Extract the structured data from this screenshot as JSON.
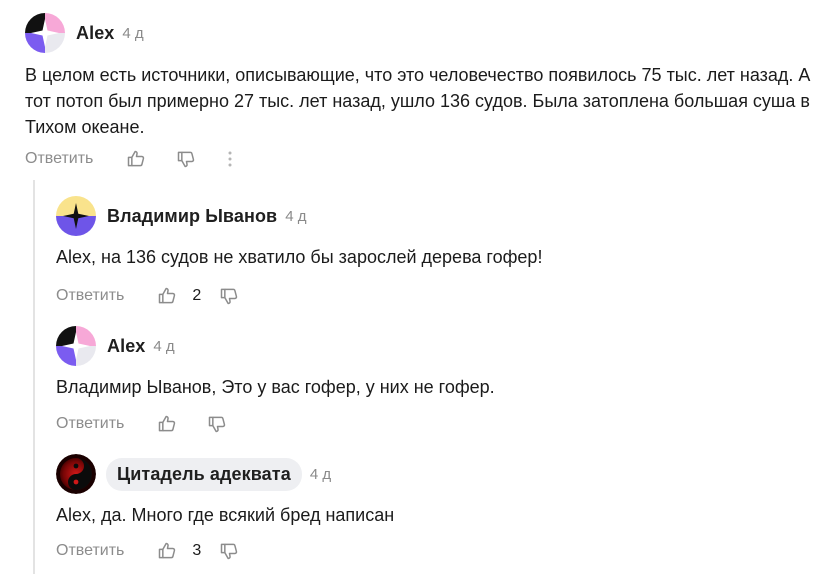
{
  "comments": [
    {
      "author": "Alex",
      "time": "4 д",
      "text": "В целом есть источники, описывающие, что это человечество появилось 75 тыс. лет назад. А тот потоп был примерно 27 тыс. лет назад, ушло 136 судов. Была затоплена большая суша в Тихом океане.",
      "reply_label": "Ответить",
      "likes": ""
    },
    {
      "author": "Владимир Ыванов",
      "time": "4 д",
      "text": "Alex, на 136 судов не хватило бы зарослей дерева гофер!",
      "reply_label": "Ответить",
      "likes": "2"
    },
    {
      "author": "Alex",
      "time": "4 д",
      "text": "Владимир Ыванов, Это у вас гофер, у них не гофер.",
      "reply_label": "Ответить",
      "likes": ""
    },
    {
      "author": "Цитадель адеквата",
      "time": "4 д",
      "text": "Alex, да. Много где всякий бред написан",
      "reply_label": "Ответить",
      "likes": "3"
    }
  ],
  "icons": {
    "like": "thumb-up-icon",
    "dislike": "thumb-down-icon",
    "more": "more-vertical-icon"
  },
  "colors": {
    "muted_text": "#8c8c8c",
    "thread_line": "#e3e3e3",
    "pill_bg": "#eeeff2"
  }
}
